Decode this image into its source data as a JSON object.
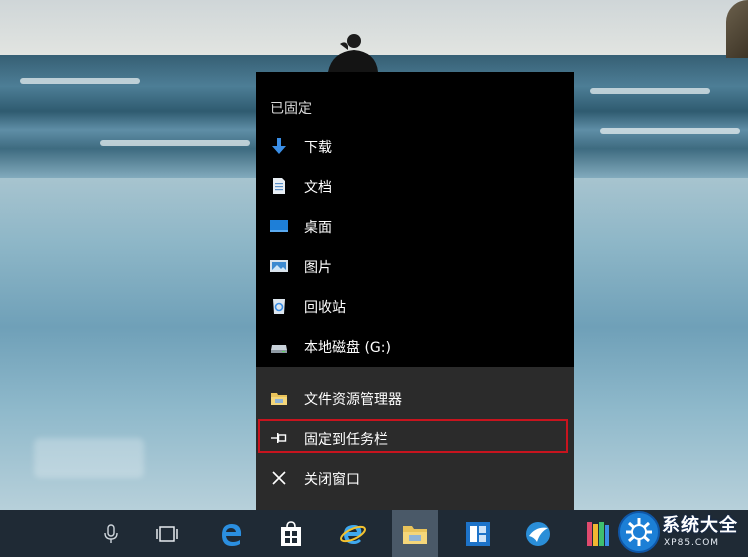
{
  "jumplist": {
    "section_title": "已固定",
    "pinned_items": [
      {
        "label": "下载",
        "icon": "download-arrow-icon"
      },
      {
        "label": "文档",
        "icon": "document-icon"
      },
      {
        "label": "桌面",
        "icon": "desktop-icon"
      },
      {
        "label": "图片",
        "icon": "pictures-icon"
      },
      {
        "label": "回收站",
        "icon": "recycle-bin-icon"
      },
      {
        "label": "本地磁盘 (G:)",
        "icon": "drive-icon"
      }
    ],
    "actions": [
      {
        "label": "文件资源管理器",
        "icon": "file-explorer-icon"
      },
      {
        "label": "固定到任务栏",
        "icon": "pin-icon",
        "highlighted": true
      },
      {
        "label": "关闭窗口",
        "icon": "close-icon"
      }
    ],
    "highlight_color": "#c8141e"
  },
  "taskbar": {
    "buttons": [
      "microphone-icon",
      "task-view-icon",
      "edge-icon",
      "store-icon",
      "internet-explorer-icon",
      "file-explorer-icon",
      "app-blue-icon",
      "app-globe-icon",
      "app-colorful-icon"
    ],
    "active": "file-explorer-icon"
  },
  "watermark": {
    "text": "系统大全",
    "subtext": "XP85.COM"
  }
}
